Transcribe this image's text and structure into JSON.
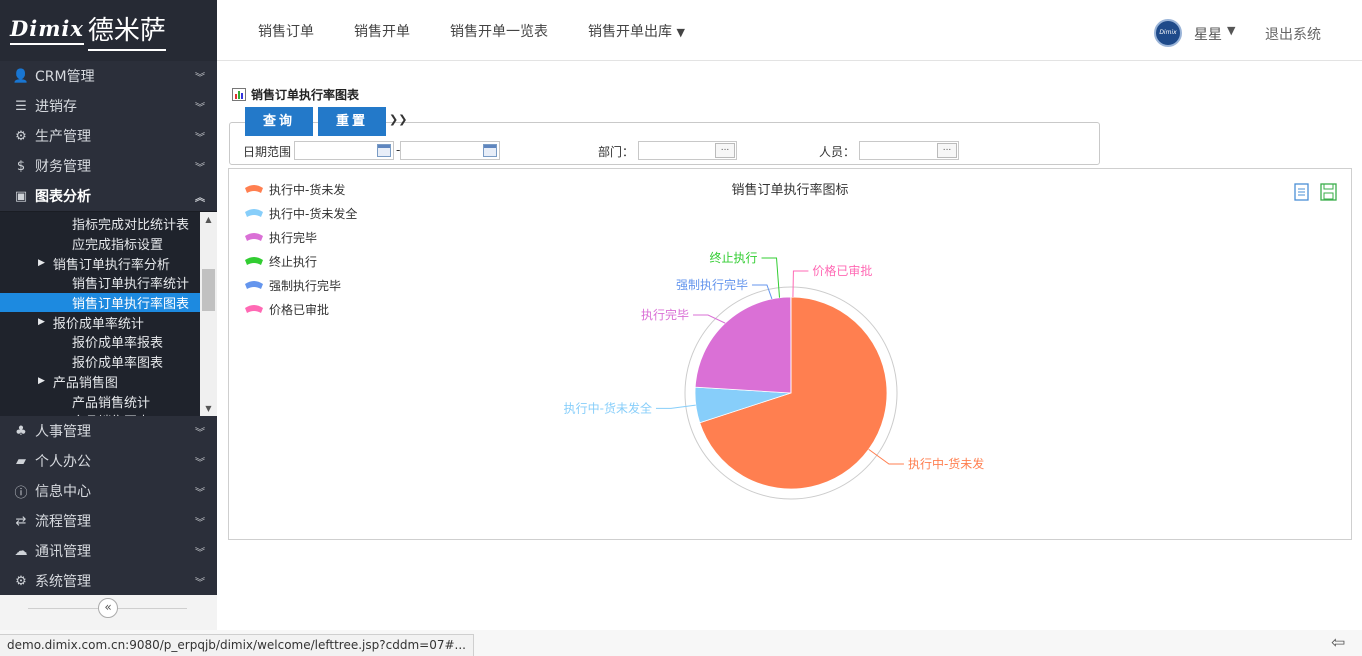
{
  "logo": {
    "brand": "Dimix",
    "brand_cn": "德米萨"
  },
  "sidebar": {
    "top_items": [
      {
        "label": "CRM管理",
        "icon": "user-icon"
      },
      {
        "label": "进销存",
        "icon": "list-icon"
      },
      {
        "label": "生产管理",
        "icon": "gears-icon"
      },
      {
        "label": "财务管理",
        "icon": "dollar-icon"
      },
      {
        "label": "图表分析",
        "icon": "image-icon"
      }
    ],
    "tree": [
      {
        "label": "指标完成对比统计表",
        "level": 2
      },
      {
        "label": "应完成指标设置",
        "level": 2
      },
      {
        "label": "销售订单执行率分析",
        "level": 1
      },
      {
        "label": "销售订单执行率统计",
        "level": 2
      },
      {
        "label": "销售订单执行率图表",
        "level": 2
      },
      {
        "label": "报价成单率统计",
        "level": 1
      },
      {
        "label": "报价成单率报表",
        "level": 2
      },
      {
        "label": "报价成单率图表",
        "level": 2
      },
      {
        "label": "产品销售图",
        "level": 1
      },
      {
        "label": "产品销售统计",
        "level": 2
      },
      {
        "label": "产品销售图表",
        "level": 2
      }
    ],
    "bottom_items": [
      {
        "label": "人事管理",
        "icon": "people-icon"
      },
      {
        "label": "个人办公",
        "icon": "briefcase-icon"
      },
      {
        "label": "信息中心",
        "icon": "info-icon"
      },
      {
        "label": "流程管理",
        "icon": "exchange-icon"
      },
      {
        "label": "通讯管理",
        "icon": "chat-icon"
      },
      {
        "label": "系统管理",
        "icon": "gear-icon"
      }
    ]
  },
  "header": {
    "nav": [
      {
        "label": "销售订单"
      },
      {
        "label": "销售开单"
      },
      {
        "label": "销售开单一览表"
      },
      {
        "label": "销售开单出库"
      }
    ],
    "user_name": "星星",
    "logout": "退出系统"
  },
  "page": {
    "title": "销售订单执行率图表"
  },
  "query": {
    "query_btn": "查询",
    "reset_btn": "重置",
    "date_label": "日期范围",
    "date_sep": "-",
    "dept_label": "部门：",
    "person_label": "人员："
  },
  "chart_data": {
    "type": "pie",
    "title": "销售订单执行率图标",
    "categories": [
      "执行中-货未发",
      "执行中-货未发全",
      "执行完毕",
      "终止执行",
      "强制执行完毕",
      "价格已审批"
    ],
    "values": [
      70,
      6,
      24,
      0.01,
      0.01,
      0.01
    ],
    "colors": [
      "#ff7f50",
      "#87cefa",
      "#da70d6",
      "#32cd32",
      "#6495ed",
      "#ff69b4"
    ],
    "legend_position": "top-left"
  },
  "status_bar": {
    "url": "demo.dimix.com.cn:9080/p_erpqjb/dimix/welcome/lefttree.jsp?cddm=07#..."
  }
}
